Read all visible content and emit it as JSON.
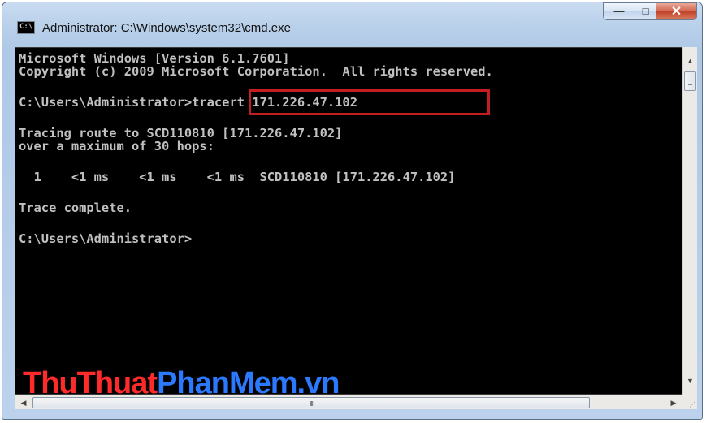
{
  "window": {
    "title": "Administrator: C:\\Windows\\system32\\cmd.exe",
    "icon_label": "C:\\",
    "buttons": {
      "minimize": "—",
      "maximize": "□",
      "close": "✕"
    }
  },
  "console": {
    "lines": [
      "Microsoft Windows [Version 6.1.7601]",
      "Copyright (c) 2009 Microsoft Corporation.  All rights reserved.",
      "",
      "C:\\Users\\Administrator>tracert 171.226.47.102",
      "",
      "Tracing route to SCD110810 [171.226.47.102]",
      "over a maximum of 30 hops:",
      "",
      "  1    <1 ms    <1 ms    <1 ms  SCD110810 [171.226.47.102]",
      "",
      "Trace complete.",
      "",
      "C:\\Users\\Administrator>"
    ],
    "highlighted_command": "tracert 171.226.47.102",
    "highlight_color": "#c21e22",
    "text_color": "#c0c0c0",
    "background_color": "#000000"
  },
  "scrollbars": {
    "vertical": {
      "up": "▲",
      "down": "▼"
    },
    "horizontal": {
      "left": "◀",
      "right": "▶",
      "grip": "III"
    },
    "corner": "⋰"
  },
  "watermark": {
    "part1": "ThuThuat",
    "part2": "PhanMem",
    "part3": ".vn"
  }
}
